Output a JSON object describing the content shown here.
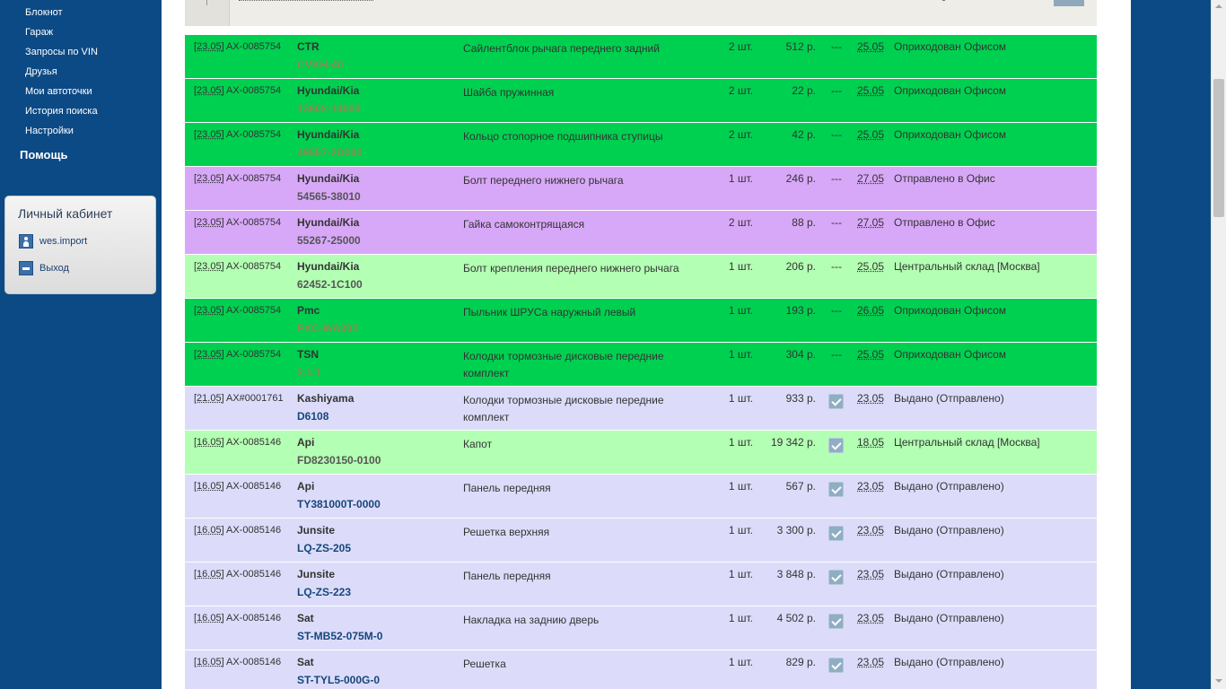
{
  "sidebar": {
    "links": [
      "Блокнот",
      "Гараж",
      "Запросы по VIN",
      "Друзья",
      "Мои автоточки",
      "История поиска",
      "Настройки"
    ],
    "help": "Помощь"
  },
  "cabinet": {
    "title": "Личный кабинет",
    "user": "wes.import",
    "logout": "Выход"
  },
  "orders": [
    {
      "status_color": "green",
      "date": "[23.05]",
      "order": "AX-0085754",
      "brand": "CTR",
      "article": "CVKH-40",
      "name": "Сайлентблок рычага переднего задний",
      "qty": "2 шт.",
      "price": "512 р.",
      "mark": "---",
      "delivery": "25.05",
      "status": "Оприходован Офисом"
    },
    {
      "status_color": "green",
      "date": "[23.05]",
      "order": "AX-0085754",
      "brand": "Hyundai/Kia",
      "article": "13602-14003",
      "name": "Шайба пружинная",
      "qty": "2 шт.",
      "price": "22 р.",
      "mark": "---",
      "delivery": "25.05",
      "status": "Оприходован Офисом"
    },
    {
      "status_color": "green",
      "date": "[23.05]",
      "order": "AX-0085754",
      "brand": "Hyundai/Kia",
      "article": "49557-2D000",
      "name": "Кольцо стопорное подшипника ступицы",
      "qty": "2 шт.",
      "price": "42 р.",
      "mark": "---",
      "delivery": "25.05",
      "status": "Оприходован Офисом"
    },
    {
      "status_color": "violet",
      "date": "[23.05]",
      "order": "AX-0085754",
      "brand": "Hyundai/Kia",
      "article": "54565-38010",
      "name": "Болт переднего нижнего рычага",
      "qty": "1 шт.",
      "price": "246 р.",
      "mark": "---",
      "delivery": "27.05",
      "status": "Отправлено в Офис"
    },
    {
      "status_color": "violet",
      "date": "[23.05]",
      "order": "AX-0085754",
      "brand": "Hyundai/Kia",
      "article": "55267-25000",
      "name": "Гайка самоконтрящаяся",
      "qty": "2 шт.",
      "price": "88 р.",
      "mark": "---",
      "delivery": "27.05",
      "status": "Отправлено в Офис"
    },
    {
      "status_color": "light",
      "date": "[23.05]",
      "order": "AX-0085754",
      "brand": "Hyundai/Kia",
      "article": "62452-1C100",
      "name": "Болт крепления переднего нижнего рычага",
      "qty": "1 шт.",
      "price": "206 р.",
      "mark": "---",
      "delivery": "25.05",
      "status": "Центральный склад [Москва]"
    },
    {
      "status_color": "green",
      "date": "[23.05]",
      "order": "AX-0085754",
      "brand": "Pmc",
      "article": "PXC-WA302",
      "name": "Пыльник ШРУСа наружный левый",
      "qty": "1 шт.",
      "price": "193 р.",
      "mark": "---",
      "delivery": "26.05",
      "status": "Оприходован Офисом"
    },
    {
      "status_color": "green",
      "date": "[23.05]",
      "order": "AX-0085754",
      "brand": "TSN",
      "article": "2.1.1",
      "name": "Колодки тормозные дисковые передние комплект",
      "qty": "1 шт.",
      "price": "304 р.",
      "mark": "---",
      "delivery": "25.05",
      "status": "Оприходован Офисом"
    },
    {
      "status_color": "blue",
      "date": "[21.05]",
      "order": "AX#0001761",
      "brand": "Kashiyama",
      "article": "D6108",
      "name": "Колодки тормозные дисковые передние комплект",
      "qty": "1 шт.",
      "price": "933 р.",
      "mark": "check",
      "delivery": "23.05",
      "status": "Выдано (Отправлено)"
    },
    {
      "status_color": "light",
      "date": "[16.05]",
      "order": "AX-0085146",
      "brand": "Api",
      "article": "FD8230150-0100",
      "name": "Капот",
      "qty": "1 шт.",
      "price": "19 342 р.",
      "mark": "check",
      "delivery": "18.05",
      "status": "Центральный склад [Москва]"
    },
    {
      "status_color": "blue",
      "date": "[16.05]",
      "order": "AX-0085146",
      "brand": "Api",
      "article": "TY381000T-0000",
      "name": "Панель передняя",
      "qty": "1 шт.",
      "price": "567 р.",
      "mark": "check",
      "delivery": "23.05",
      "status": "Выдано (Отправлено)"
    },
    {
      "status_color": "blue",
      "date": "[16.05]",
      "order": "AX-0085146",
      "brand": "Junsite",
      "article": "LQ-ZS-205",
      "name": "Решетка верхняя",
      "qty": "1 шт.",
      "price": "3 300 р.",
      "mark": "check",
      "delivery": "23.05",
      "status": "Выдано (Отправлено)"
    },
    {
      "status_color": "blue",
      "date": "[16.05]",
      "order": "AX-0085146",
      "brand": "Junsite",
      "article": "LQ-ZS-223",
      "name": "Панель передняя",
      "qty": "1 шт.",
      "price": "3 848 р.",
      "mark": "check",
      "delivery": "23.05",
      "status": "Выдано (Отправлено)"
    },
    {
      "status_color": "blue",
      "date": "[16.05]",
      "order": "AX-0085146",
      "brand": "Sat",
      "article": "ST-MB52-075M-0",
      "name": "Накладка на заднию дверь",
      "qty": "1 шт.",
      "price": "4 502 р.",
      "mark": "check",
      "delivery": "23.05",
      "status": "Выдано (Отправлено)"
    },
    {
      "status_color": "blue",
      "date": "[16.05]",
      "order": "AX-0085146",
      "brand": "Sat",
      "article": "ST-TYL5-000G-0",
      "name": "Решетка",
      "qty": "1 шт.",
      "price": "829 р.",
      "mark": "check",
      "delivery": "23.05",
      "status": "Выдано (Отправлено)"
    }
  ],
  "colors": {
    "green": "#00d050",
    "violet": "#d8a8f8",
    "light": "#b3ffb3",
    "blue": "#dcdcfa",
    "page_bg": "#0c4a85"
  }
}
